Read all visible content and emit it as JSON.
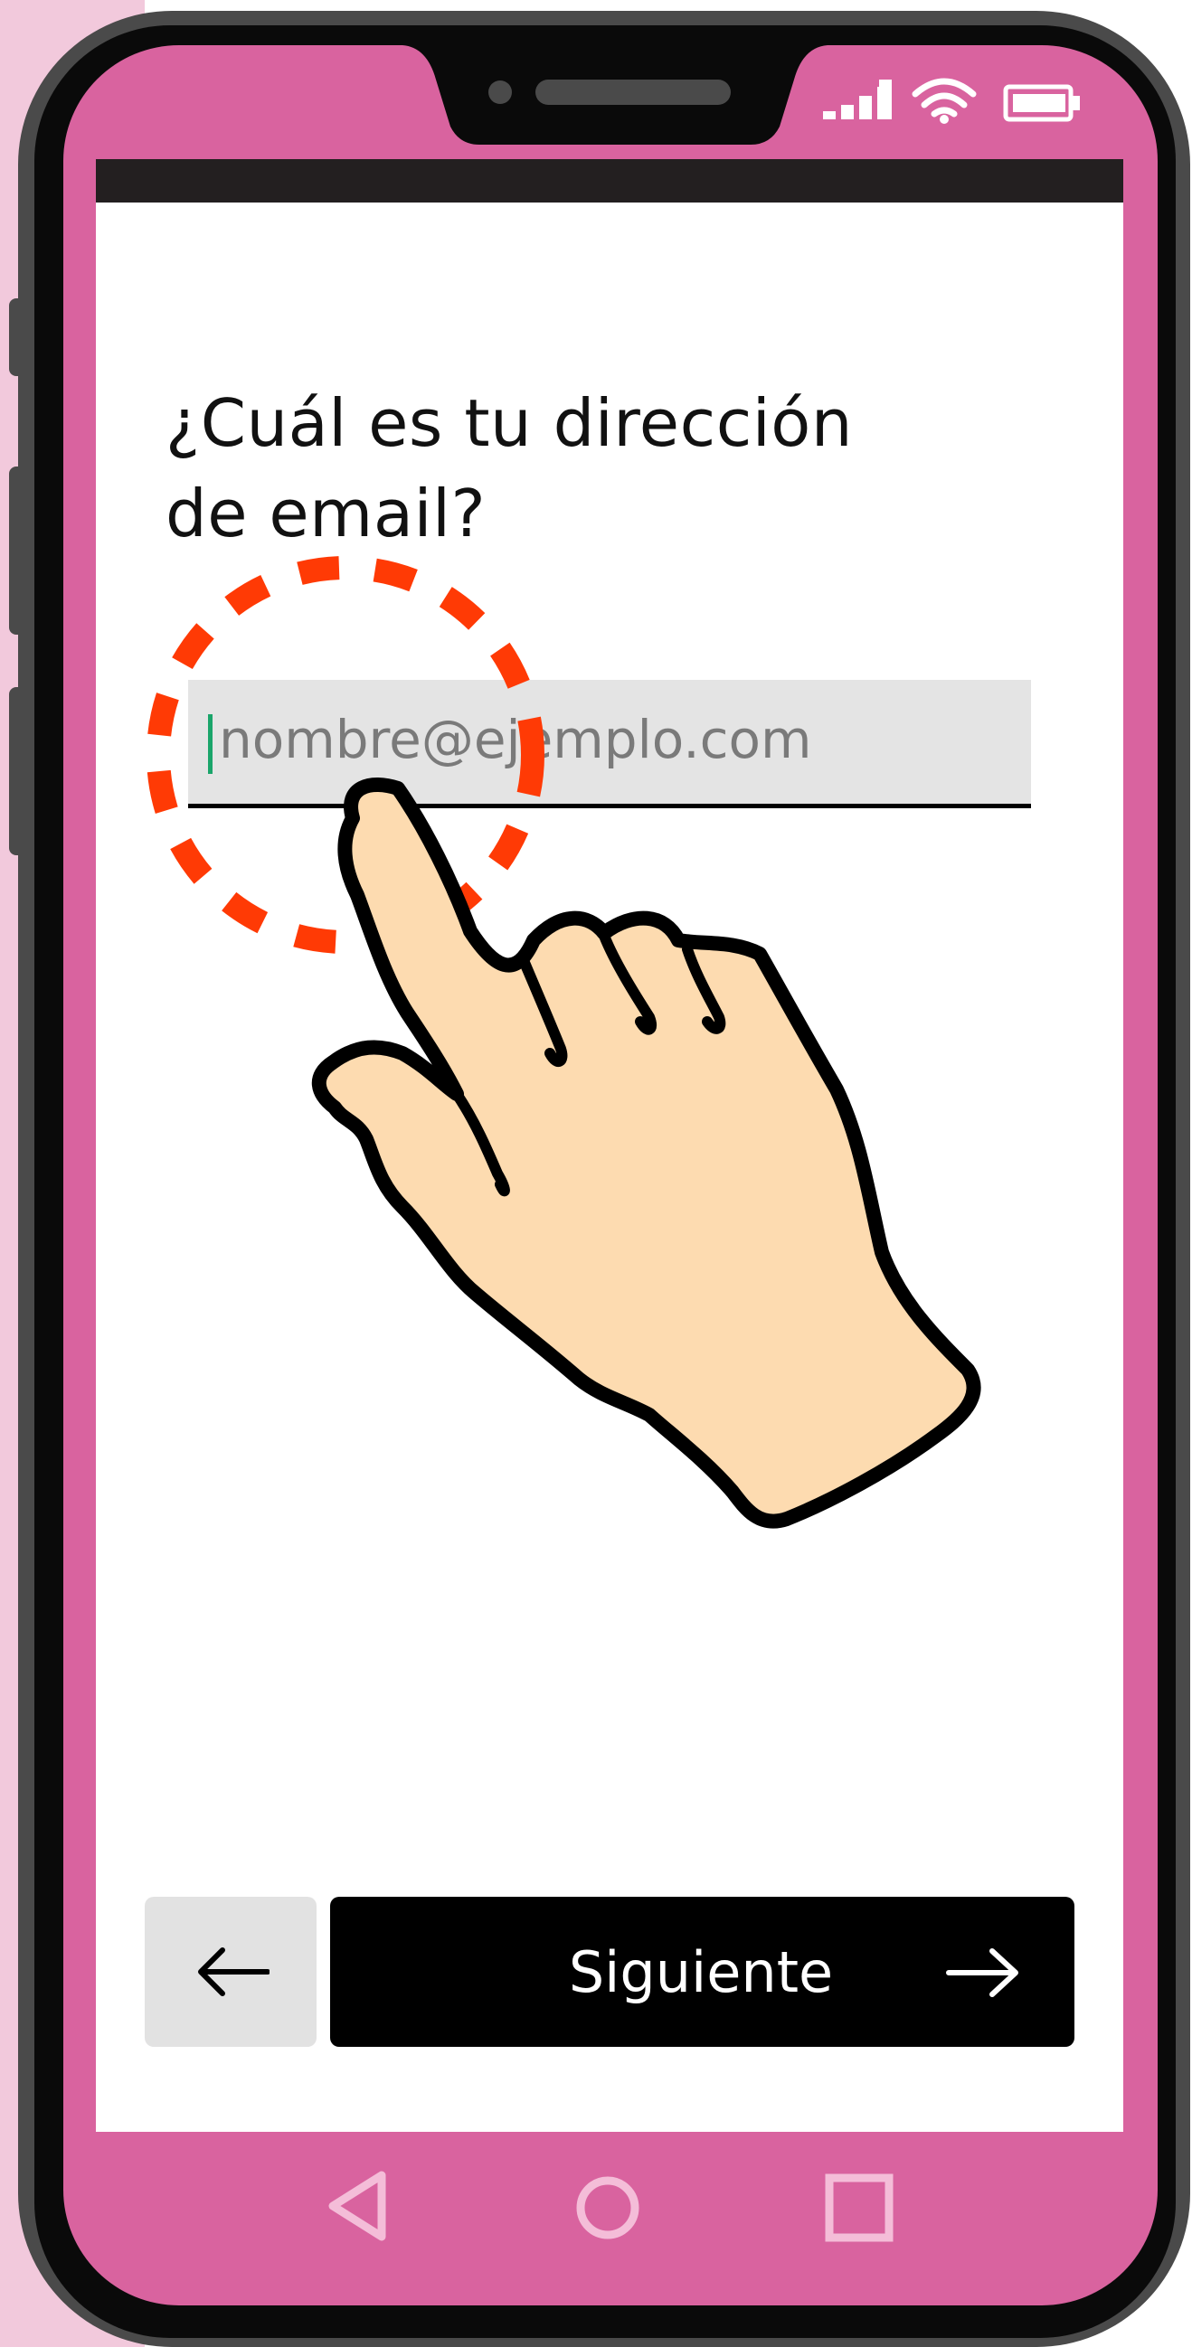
{
  "screen": {
    "question_line1": "¿Cuál es tu dirección",
    "question_line2": "de email?"
  },
  "email_field": {
    "placeholder": "nombre@ejemplo.com",
    "value": ""
  },
  "footer": {
    "next_label": "Siguiente"
  },
  "icons": {
    "signal": "signal-strength-icon",
    "wifi": "wifi-icon",
    "battery": "battery-icon",
    "back_arrow": "arrow-left-icon",
    "next_arrow": "arrow-right-icon",
    "nav_back": "triangle-back-icon",
    "nav_home": "circle-home-icon",
    "nav_recent": "square-recent-icon",
    "tap_hand": "pointing-hand-icon",
    "tap_target": "dashed-circle-highlight-icon"
  },
  "colors": {
    "phone_body": "#d9639f",
    "phone_frame": "#0a0a0a",
    "accent_dashed_circle": "#ff3a05",
    "hand_skin": "#fddbb0",
    "caret": "#1aa56a",
    "next_button": "#000000",
    "back_button": "#e2e2e2"
  }
}
